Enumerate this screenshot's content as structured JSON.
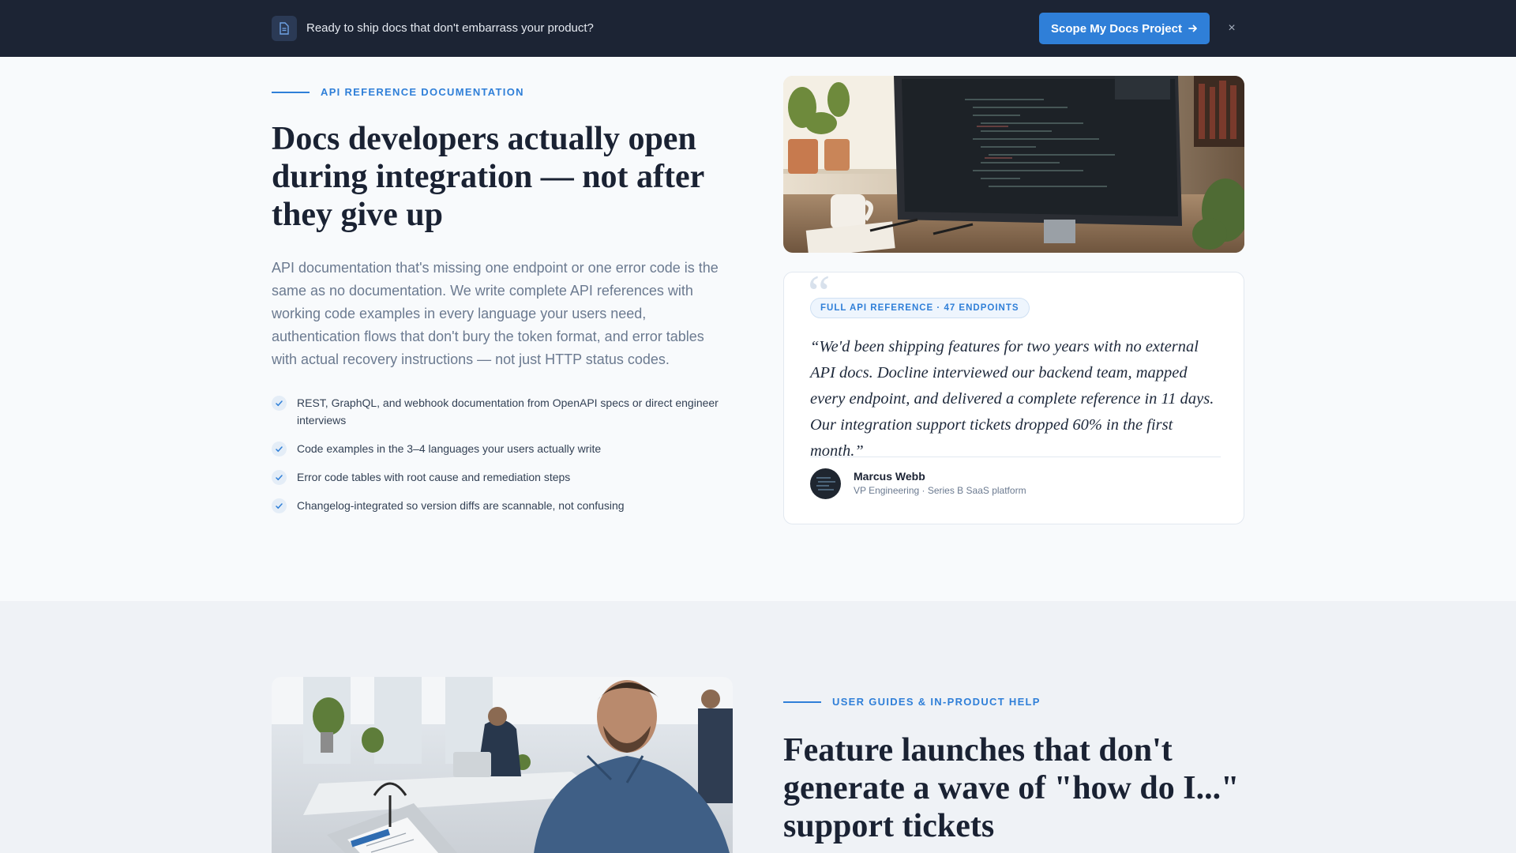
{
  "banner": {
    "icon": "document-icon",
    "text": "Ready to ship docs that don't embarrass your product?",
    "cta_label": "Scope My Docs Project",
    "cta_icon": "arrow-right-icon",
    "close_label": "×"
  },
  "section1": {
    "eyebrow": "API REFERENCE DOCUMENTATION",
    "title_lines": [
      "Docs developers actually open",
      "during integration — not after",
      "they give up"
    ],
    "lead": "API documentation that's missing one endpoint or one error code is the same as no documentation. We write complete API references with working code examples in every language your users need, authentication flows that don't bury the token format, and error tables with actual recovery instructions — not just HTTP status codes.",
    "bullets": [
      "REST, GraphQL, and webhook documentation from OpenAPI specs or direct engineer interviews",
      "Code examples in the 3–4 languages your users actually write",
      "Error code tables with root cause and remediation steps",
      "Changelog-integrated so version diffs are scannable, not confusing"
    ],
    "testimonial": {
      "quote_mark": "“",
      "badge": "FULL API REFERENCE · 47 ENDPOINTS",
      "quote": "“We'd been shipping features for two years with no external API docs. Docline interviewed our backend team, mapped every endpoint, and delivered a complete reference in 11 days. Our integration support tickets dropped 60% in the first month.”",
      "author_name": "Marcus Webb",
      "author_role": "VP Engineering · Series B SaaS platform"
    }
  },
  "section2": {
    "eyebrow": "USER GUIDES & IN-PRODUCT HELP",
    "title_lines": [
      "Feature launches that don't",
      "generate a wave of \"how do I...\"",
      "support tickets"
    ]
  },
  "colors": {
    "accent": "#2f7fd8",
    "banner_bg": "#1c2434",
    "heading": "#1a2233",
    "body_text": "#6b7a90"
  }
}
